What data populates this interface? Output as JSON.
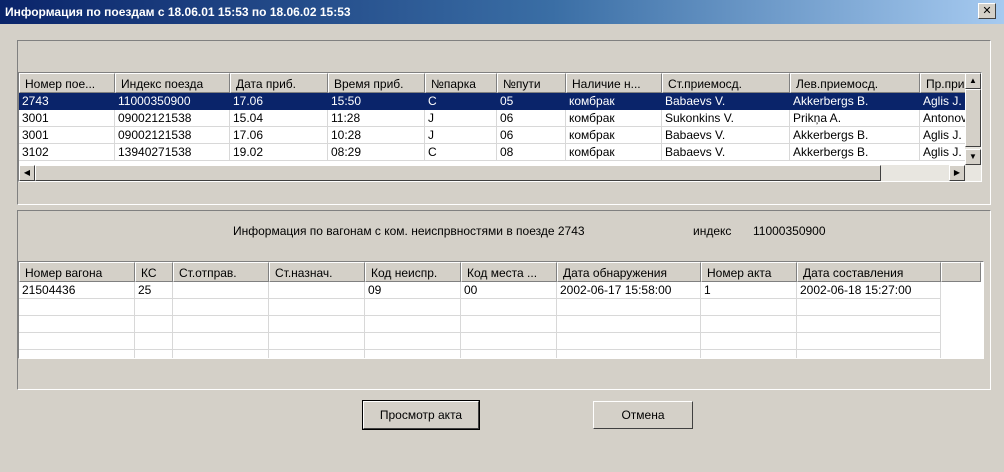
{
  "window": {
    "title": "Информация по поездам с 18.06.01 15:53 по 18.06.02 15:53",
    "close_glyph": "✕"
  },
  "trains": {
    "columns": [
      "Номер пое...",
      "Индекс поезда",
      "Дата приб.",
      "Время приб.",
      "№парка",
      "№пути",
      "Наличие н...",
      "Ст.приемосд.",
      "Лев.приемосд.",
      "Пр.при"
    ],
    "rows": [
      [
        "2743",
        "11000350900",
        "17.06",
        "15:50",
        "C",
        "05",
        "комбрак",
        "Babaevs V.",
        "Akkerbergs B.",
        "Aglis J."
      ],
      [
        "3001",
        "09002121538",
        "15.04",
        "11:28",
        "J",
        "06",
        "комбрак",
        "Sukonkins V.",
        "Prikņa A.",
        "Antonov"
      ],
      [
        "3001",
        "09002121538",
        "17.06",
        "10:28",
        "J",
        "06",
        "комбрак",
        "Babaevs V.",
        "Akkerbergs B.",
        "Aglis J."
      ],
      [
        "3102",
        "13940271538",
        "19.02",
        "08:29",
        "C",
        "08",
        "комбрак",
        "Babaevs V.",
        "Akkerbergs B.",
        "Aglis J."
      ]
    ],
    "selected_row": 0
  },
  "info": {
    "heading": "Информация по вагонам с ком. неиспрвностями в поезде 2743",
    "index_label": "индекс",
    "index_value": "11000350900"
  },
  "wagons": {
    "columns": [
      "Номер вагона",
      "КС",
      "Ст.отправ.",
      "Ст.назнач.",
      "Код неиспр.",
      "Код места ...",
      "Дата обнаружения",
      "Номер акта",
      "Дата составления"
    ],
    "rows": [
      [
        "21504436",
        "25",
        "",
        "",
        "09",
        "00",
        "2002-06-17 15:58:00",
        "1",
        "2002-06-18 15:27:00"
      ]
    ],
    "empty_rows": 4
  },
  "buttons": {
    "view_act": "Просмотр акта",
    "cancel": "Отмена"
  },
  "icons": {
    "arrow_up": "▲",
    "arrow_down": "▼",
    "arrow_left": "◀",
    "arrow_right": "▶"
  }
}
